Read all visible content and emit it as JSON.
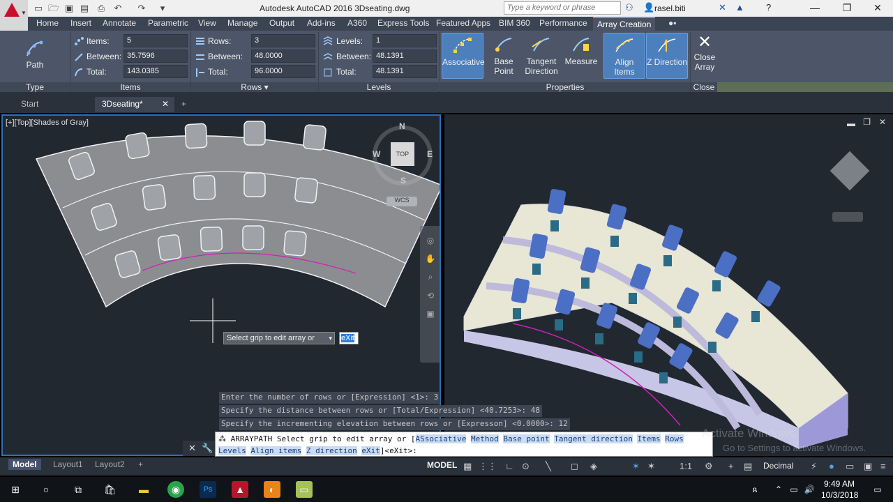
{
  "titlebar": {
    "title": "Autodesk AutoCAD 2016    3Dseating.dwg",
    "search_placeholder": "Type a keyword or phrase",
    "user": "rasel.biti"
  },
  "ribbon_tabs": [
    "Home",
    "Insert",
    "Annotate",
    "Parametric",
    "View",
    "Manage",
    "Output",
    "Add-ins",
    "A360",
    "Express Tools",
    "Featured Apps",
    "BIM 360",
    "Performance",
    "Array Creation"
  ],
  "ribbon": {
    "type_panel": {
      "title": "Type",
      "path_label": "Path"
    },
    "items_panel": {
      "title": "Items",
      "items_label": "Items:",
      "items_value": "5",
      "between_label": "Between:",
      "between_value": "35.7596",
      "total_label": "Total:",
      "total_value": "143.0385"
    },
    "rows_panel": {
      "title": "Rows",
      "rows_label": "Rows:",
      "rows_value": "3",
      "between_label": "Between:",
      "between_value": "48.0000",
      "total_label": "Total:",
      "total_value": "96.0000"
    },
    "levels_panel": {
      "title": "Levels",
      "levels_label": "Levels:",
      "levels_value": "1",
      "between_label": "Between:",
      "between_value": "48.1391",
      "total_label": "Total:",
      "total_value": "48.1391"
    },
    "properties_panel": {
      "title": "Properties",
      "associative": "Associative",
      "base_point": "Base Point",
      "tangent_direction_1": "Tangent",
      "tangent_direction_2": "Direction",
      "measure": "Measure",
      "align_items": "Align Items",
      "z_direction": "Z Direction"
    },
    "close_panel": {
      "title": "Close",
      "close_1": "Close",
      "close_2": "Array"
    }
  },
  "doc_tabs": {
    "start": "Start",
    "current": "3Dseating*"
  },
  "viewport_left": {
    "label": "[+][Top][Shades of Gray]",
    "viewcube_face": "TOP",
    "compass": {
      "n": "N",
      "s": "S",
      "e": "E",
      "w": "W"
    },
    "wcs": "WCS"
  },
  "prompt": {
    "text": "Select grip to edit array or",
    "option": "eXit"
  },
  "command_history": [
    "Enter the number of rows or [Expression] <1>: 3",
    "Specify the distance between rows or [Total/Expression] <40.7253>: 48",
    "Specify the incrementing elevation between rows or [Expresson] <0.0000>: 12"
  ],
  "command_line": {
    "cmd": "ARRAYPATH Select grip to edit array or [",
    "kw_associative": "ASsociative",
    "kw_method": "Method",
    "kw_base": "Base point",
    "kw_tangent": "Tangent direction",
    "kw_items": "Items",
    "kw_rows": "Rows",
    "kw_levels": "Levels",
    "kw_align": "Align items",
    "kw_z": "Z direction",
    "kw_exit": "eXit",
    "tail": "]<eXit>:"
  },
  "layout_tabs": [
    "Model",
    "Layout1",
    "Layout2"
  ],
  "status": {
    "model": "MODEL",
    "scale": "1:1",
    "units": "Decimal"
  },
  "watermark": {
    "line1": "Activate Windows",
    "line2": "Go to Settings to activate Windows."
  },
  "clock": {
    "time": "9:49 AM",
    "date": "10/3/2018"
  },
  "colors": {
    "accent": "#4d7fbd",
    "chair": "#4a6fc4",
    "path": "#d01fb7"
  }
}
